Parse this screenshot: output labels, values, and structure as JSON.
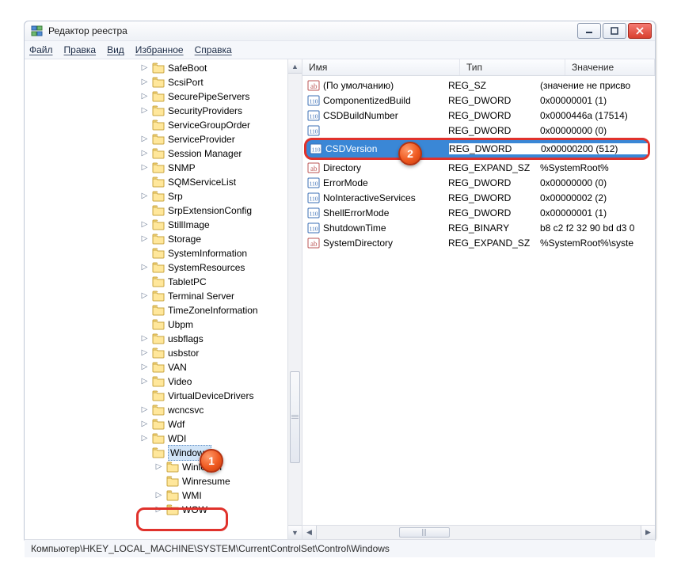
{
  "window": {
    "title": "Редактор реестра"
  },
  "menu": {
    "file": "Файл",
    "edit": "Правка",
    "view": "Вид",
    "favorites": "Избранное",
    "help": "Справка"
  },
  "columns": {
    "name": "Имя",
    "type": "Тип",
    "data": "Значение"
  },
  "statusbar": "Компьютер\\HKEY_LOCAL_MACHINE\\SYSTEM\\CurrentControlSet\\Control\\Windows",
  "badges": {
    "one": "1",
    "two": "2"
  },
  "tree": [
    {
      "label": "SafeBoot",
      "exp": true,
      "sel": false,
      "indent": 0
    },
    {
      "label": "ScsiPort",
      "exp": true,
      "sel": false,
      "indent": 0
    },
    {
      "label": "SecurePipeServers",
      "exp": true,
      "sel": false,
      "indent": 0
    },
    {
      "label": "SecurityProviders",
      "exp": true,
      "sel": false,
      "indent": 0
    },
    {
      "label": "ServiceGroupOrder",
      "exp": false,
      "sel": false,
      "indent": 0
    },
    {
      "label": "ServiceProvider",
      "exp": true,
      "sel": false,
      "indent": 0
    },
    {
      "label": "Session Manager",
      "exp": true,
      "sel": false,
      "indent": 0
    },
    {
      "label": "SNMP",
      "exp": true,
      "sel": false,
      "indent": 0
    },
    {
      "label": "SQMServiceList",
      "exp": false,
      "sel": false,
      "indent": 0
    },
    {
      "label": "Srp",
      "exp": true,
      "sel": false,
      "indent": 0
    },
    {
      "label": "SrpExtensionConfig",
      "exp": false,
      "sel": false,
      "indent": 0
    },
    {
      "label": "StillImage",
      "exp": true,
      "sel": false,
      "indent": 0
    },
    {
      "label": "Storage",
      "exp": true,
      "sel": false,
      "indent": 0
    },
    {
      "label": "SystemInformation",
      "exp": false,
      "sel": false,
      "indent": 0
    },
    {
      "label": "SystemResources",
      "exp": true,
      "sel": false,
      "indent": 0
    },
    {
      "label": "TabletPC",
      "exp": false,
      "sel": false,
      "indent": 0
    },
    {
      "label": "Terminal Server",
      "exp": true,
      "sel": false,
      "indent": 0
    },
    {
      "label": "TimeZoneInformation",
      "exp": false,
      "sel": false,
      "indent": 0
    },
    {
      "label": "Ubpm",
      "exp": false,
      "sel": false,
      "indent": 0
    },
    {
      "label": "usbflags",
      "exp": true,
      "sel": false,
      "indent": 0
    },
    {
      "label": "usbstor",
      "exp": true,
      "sel": false,
      "indent": 0
    },
    {
      "label": "VAN",
      "exp": true,
      "sel": false,
      "indent": 0
    },
    {
      "label": "Video",
      "exp": true,
      "sel": false,
      "indent": 0
    },
    {
      "label": "VirtualDeviceDrivers",
      "exp": false,
      "sel": false,
      "indent": 0
    },
    {
      "label": "wcncsvc",
      "exp": true,
      "sel": false,
      "indent": 0
    },
    {
      "label": "Wdf",
      "exp": true,
      "sel": false,
      "indent": 0
    },
    {
      "label": "WDI",
      "exp": true,
      "sel": false,
      "indent": 0
    },
    {
      "label": "Windows",
      "exp": false,
      "sel": true,
      "indent": 0
    },
    {
      "label": "Winlogon",
      "exp": true,
      "sel": false,
      "indent": 1
    },
    {
      "label": "Winresume",
      "exp": false,
      "sel": false,
      "indent": 1
    },
    {
      "label": "WMI",
      "exp": true,
      "sel": false,
      "indent": 1
    },
    {
      "label": "WOW",
      "exp": true,
      "sel": false,
      "indent": 1
    }
  ],
  "values": [
    {
      "icon": "str",
      "name": "(По умолчанию)",
      "type": "REG_SZ",
      "data": "(значение не присво"
    },
    {
      "icon": "bin",
      "name": "ComponentizedBuild",
      "type": "REG_DWORD",
      "data": "0x00000001 (1)"
    },
    {
      "icon": "bin",
      "name": "CSDBuildNumber",
      "type": "REG_DWORD",
      "data": "0x0000446a (17514)"
    },
    {
      "icon": "bin",
      "name": "",
      "type": "REG_DWORD",
      "data": "0x00000000 (0)"
    },
    {
      "icon": "bin",
      "name": "CSDVersion",
      "type": "REG_DWORD",
      "data": "0x00000200 (512)",
      "selected": true
    },
    {
      "icon": "str",
      "name": "Directory",
      "type": "REG_EXPAND_SZ",
      "data": "%SystemRoot%"
    },
    {
      "icon": "bin",
      "name": "ErrorMode",
      "type": "REG_DWORD",
      "data": "0x00000000 (0)"
    },
    {
      "icon": "bin",
      "name": "NoInteractiveServices",
      "type": "REG_DWORD",
      "data": "0x00000002 (2)"
    },
    {
      "icon": "bin",
      "name": "ShellErrorMode",
      "type": "REG_DWORD",
      "data": "0x00000001 (1)"
    },
    {
      "icon": "bin",
      "name": "ShutdownTime",
      "type": "REG_BINARY",
      "data": "b8 c2 f2 32 90 bd d3 0"
    },
    {
      "icon": "str",
      "name": "SystemDirectory",
      "type": "REG_EXPAND_SZ",
      "data": "%SystemRoot%\\syste"
    }
  ]
}
